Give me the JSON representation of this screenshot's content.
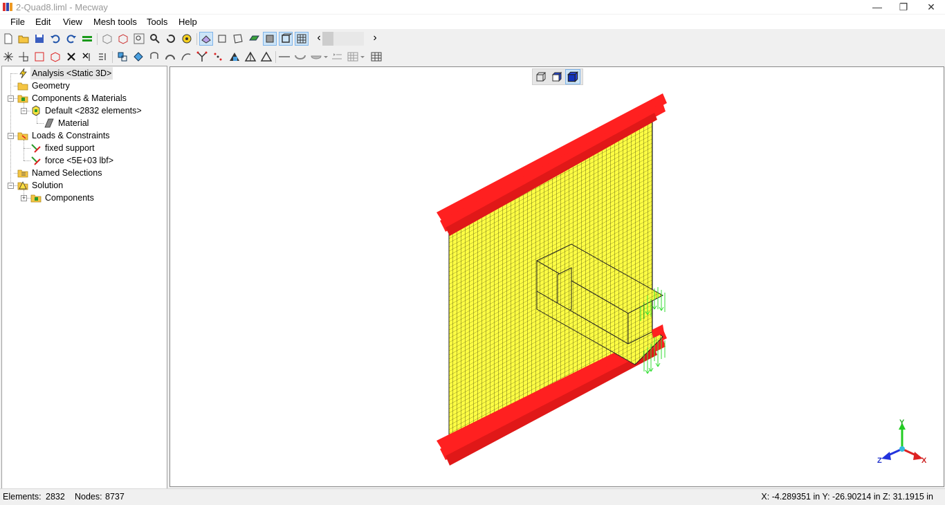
{
  "window": {
    "title": "2-Quad8.liml - Mecway",
    "minimize_glyph": "—",
    "restore_glyph": "❐",
    "close_glyph": "✕"
  },
  "menu": [
    "File",
    "Edit",
    "View",
    "Mesh tools",
    "Tools",
    "Help"
  ],
  "toolbar": {
    "scroll_left_glyph": "‹",
    "scroll_right_glyph": "›"
  },
  "tree": {
    "analysis": "Analysis <Static 3D>",
    "geometry": "Geometry",
    "components_materials": "Components & Materials",
    "default_component": "Default <2832 elements>",
    "material": "Material",
    "loads_constraints": "Loads & Constraints",
    "fixed_support": "fixed support",
    "force": "force <5E+03 lbf>",
    "named_selections": "Named Selections",
    "solution": "Solution",
    "solution_components": "Components"
  },
  "viewport": {
    "axis_x": "X",
    "axis_y": "Y",
    "axis_z": "Z",
    "mesh_color": "#ffff44",
    "constraint_color": "#ff2020",
    "force_color": "#33dd33"
  },
  "status": {
    "elements_label": "Elements:",
    "elements_value": "2832",
    "nodes_label": "Nodes:",
    "nodes_value": "8737",
    "coordinates": "X: -4.289351 in Y: -26.90214 in Z: 31.1915 in"
  }
}
